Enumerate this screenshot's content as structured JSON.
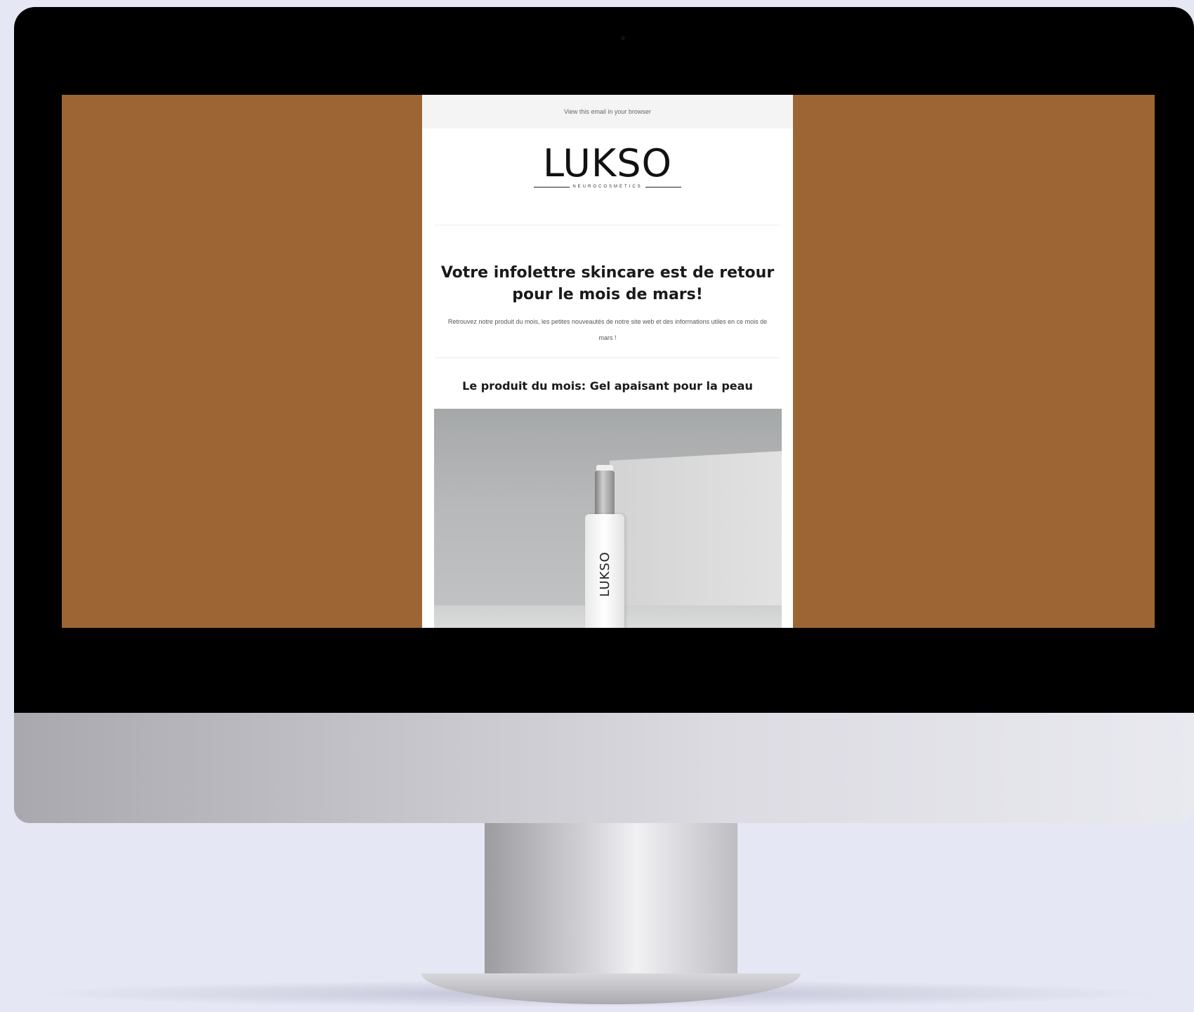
{
  "email": {
    "view_in_browser": "View this email in your browser",
    "logo": {
      "brand": "LUKSO",
      "tagline": "NEUROCOSMETICS"
    },
    "headline": "Votre infolettre skincare est de retour pour le mois de mars!",
    "intro": "Retrouvez notre produit du mois, les petites nouveautés de notre site web et des informations utiles en ce mois de mars !",
    "product_section_title": "Le produit du mois: Gel apaisant pour la peau",
    "product_image": {
      "bottle_label": "LUKSO"
    }
  },
  "colors": {
    "page_background": "#e6e7f4",
    "screen_background": "#9e6534",
    "bezel": "#000000",
    "email_background": "#ffffff"
  }
}
